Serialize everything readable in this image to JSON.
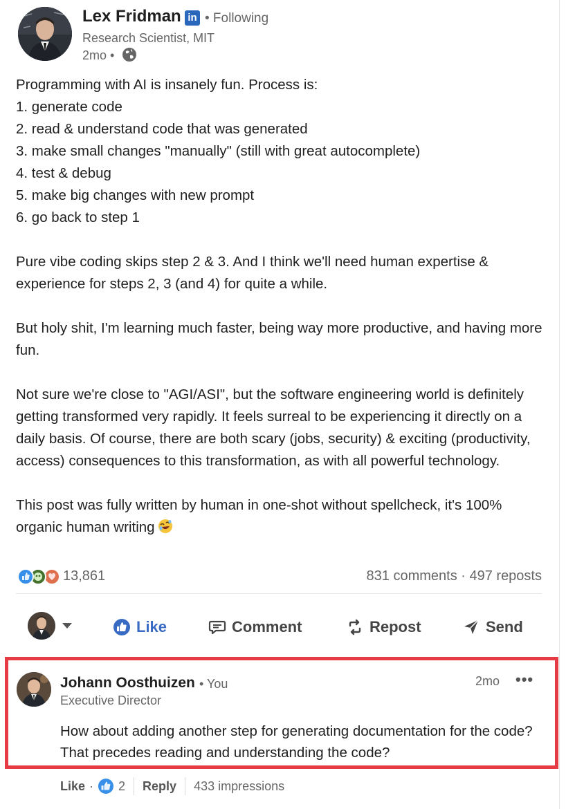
{
  "post": {
    "author": {
      "name": "Lex Fridman",
      "badge": "in",
      "follow_status": "• Following",
      "title": "Research Scientist, MIT",
      "time": "2mo •"
    },
    "body": {
      "intro": "Programming with AI is insanely fun. Process is:",
      "steps": [
        "1. generate code",
        "2. read & understand code that was generated",
        "3. make small changes \"manually\" (still with great autocomplete)",
        "4. test & debug",
        "5. make big changes with new prompt",
        "6. go back to step 1"
      ],
      "p2": "Pure vibe coding skips step 2 & 3. And I think we'll need human expertise & experience for steps 2, 3 (and 4) for quite a while.",
      "p3": "But holy shit, I'm learning much faster, being way more productive, and having more fun.",
      "p4": "Not sure we're close to \"AGI/ASI\", but the software engineering world is definitely getting transformed very rapidly. It feels surreal to be experiencing it directly on a daily basis. Of course, there are both scary (jobs, security) & exciting (productivity, access) consequences to this transformation, as with all powerful technology.",
      "p5": "This post was fully written by human in one-shot without spellcheck, it's 100% organic human writing"
    },
    "social": {
      "reaction_count": "13,861",
      "comments_reposts": "831 comments · 497 reposts"
    },
    "actions": {
      "like": "Like",
      "comment": "Comment",
      "repost": "Repost",
      "send": "Send"
    }
  },
  "comment": {
    "author": "Johann Oosthuizen",
    "you_label": "• You",
    "title": "Executive Director",
    "time": "2mo",
    "more": "•••",
    "text": "How about adding another step for generating documentation for the code? That precedes reading and understanding the code?",
    "like_label": "Like",
    "like_sep": "·",
    "like_count": "2",
    "reply_label": "Reply",
    "impressions": "433 impressions"
  },
  "colors": {
    "highlight_border": "#e63b44",
    "like_blue": "#3a6bc4",
    "linkedin_blue": "#2a66bc"
  }
}
